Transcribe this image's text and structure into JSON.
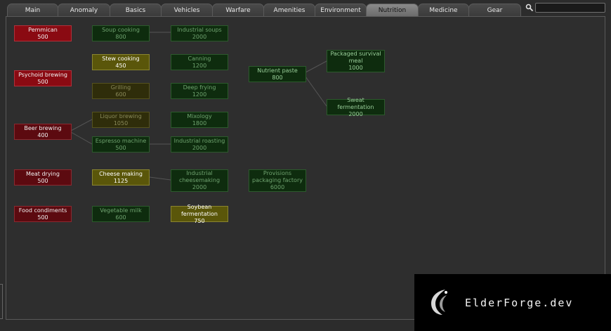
{
  "tabs": [
    {
      "label": "Main",
      "active": false
    },
    {
      "label": "Anomaly",
      "active": false
    },
    {
      "label": "Basics",
      "active": false
    },
    {
      "label": "Vehicles",
      "active": false
    },
    {
      "label": "Warfare",
      "active": false
    },
    {
      "label": "Amenities",
      "active": false
    },
    {
      "label": "Environment",
      "active": false
    },
    {
      "label": "Nutrition",
      "active": true
    },
    {
      "label": "Medicine",
      "active": false
    },
    {
      "label": "Gear",
      "active": false
    }
  ],
  "search": {
    "value": "",
    "placeholder": ""
  },
  "tree": {
    "pemmican": {
      "name": "Pemmican",
      "cost": "500",
      "state": "red-bright"
    },
    "psychoid_brewing": {
      "name": "Psychoid brewing",
      "cost": "500",
      "state": "red-bright"
    },
    "beer_brewing": {
      "name": "Beer brewing",
      "cost": "400",
      "state": "red-dark"
    },
    "meat_drying": {
      "name": "Meat drying",
      "cost": "500",
      "state": "red-dark"
    },
    "food_condiments": {
      "name": "Food condiments",
      "cost": "500",
      "state": "red-dark"
    },
    "soup_cooking": {
      "name": "Soup cooking",
      "cost": "800",
      "state": "green"
    },
    "stew_cooking": {
      "name": "Stew cooking",
      "cost": "450",
      "state": "yellow-bright"
    },
    "grilling": {
      "name": "Grilling",
      "cost": "600",
      "state": "yellow-dark"
    },
    "liquor_brewing": {
      "name": "Liquor brewing",
      "cost": "1050",
      "state": "yellow-dark"
    },
    "espresso_machine": {
      "name": "Espresso machine",
      "cost": "500",
      "state": "green"
    },
    "cheese_making": {
      "name": "Cheese making",
      "cost": "1125",
      "state": "yellow-bright"
    },
    "vegetable_milk": {
      "name": "Vegetable milk",
      "cost": "600",
      "state": "green"
    },
    "industrial_soups": {
      "name": "Industrial soups",
      "cost": "2000",
      "state": "green"
    },
    "canning": {
      "name": "Canning",
      "cost": "1200",
      "state": "green"
    },
    "deep_frying": {
      "name": "Deep frying",
      "cost": "1200",
      "state": "green"
    },
    "mixology": {
      "name": "Mixology",
      "cost": "1800",
      "state": "green"
    },
    "industrial_roasting": {
      "name": "Industrial roasting",
      "cost": "2000",
      "state": "green"
    },
    "industrial_cheesemaking": {
      "name": "Industrial cheesemaking",
      "cost": "2000",
      "state": "green"
    },
    "soybean_fermentation": {
      "name": "Soybean fermentation",
      "cost": "750",
      "state": "yellow-bright"
    },
    "nutrient_paste": {
      "name": "Nutrient paste",
      "cost": "800",
      "state": "green-bright"
    },
    "provisions_packaging_factory": {
      "name": "Provisions packaging factory",
      "cost": "6000",
      "state": "green"
    },
    "packaged_survival_meal": {
      "name": "Packaged survival meal",
      "cost": "1000",
      "state": "green-bright"
    },
    "sweat_fermentation": {
      "name": "Sweat fermentation",
      "cost": "2000",
      "state": "green-bright"
    }
  },
  "watermark": {
    "text": "ElderForge.dev"
  }
}
